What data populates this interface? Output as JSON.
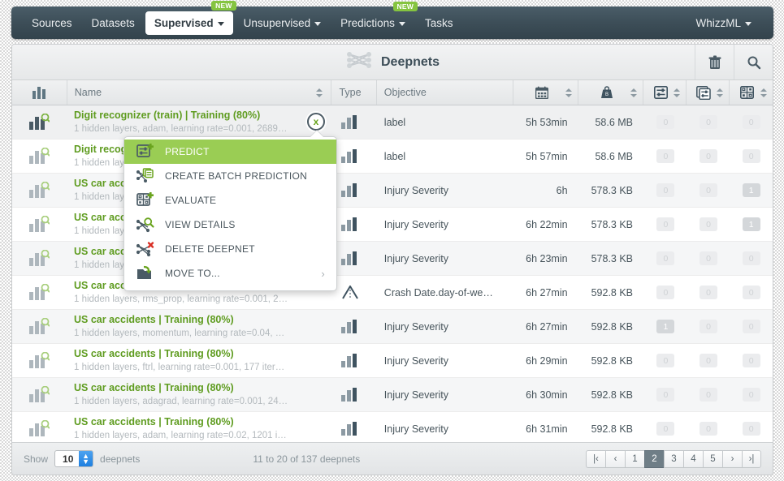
{
  "nav": {
    "items": [
      {
        "label": "Sources",
        "caret": false,
        "active": false,
        "badge": null
      },
      {
        "label": "Datasets",
        "caret": false,
        "active": false,
        "badge": null
      },
      {
        "label": "Supervised",
        "caret": true,
        "active": true,
        "badge": "NEW"
      },
      {
        "label": "Unsupervised",
        "caret": true,
        "active": false,
        "badge": null
      },
      {
        "label": "Predictions",
        "caret": true,
        "active": false,
        "badge": "NEW"
      },
      {
        "label": "Tasks",
        "caret": false,
        "active": false,
        "badge": null
      }
    ],
    "account": {
      "label": "WhizzML",
      "caret": true
    }
  },
  "titlebar": {
    "title": "Deepnets",
    "icon": "deepnet-icon",
    "actions": [
      {
        "name": "trash-icon",
        "title": "Delete"
      },
      {
        "name": "search-icon",
        "title": "Search"
      }
    ]
  },
  "table": {
    "headers": {
      "icon": "",
      "name": "Name",
      "type": "Type",
      "objective": "Objective",
      "date": "calendar-icon",
      "size": "weight-icon",
      "metric1": "prediction-icon",
      "metric2": "batch-prediction-icon",
      "metric3": "evaluation-icon"
    },
    "rows": [
      {
        "name": "Digit recognizer (train) | Training (80%)",
        "desc": "1 hidden layers, adam, learning rate=0.001, 2689…",
        "type": "classification",
        "objective": "label",
        "date": "5h 53min",
        "size": "58.6 MB",
        "m1": "0",
        "m2": "0",
        "m3": "0",
        "m1_filled": false,
        "m2_filled": false,
        "m3_filled": false
      },
      {
        "name": "Digit recognizer (train) | Training (80%)",
        "desc": "1 hidden layers, adam, learning rate=0.001, 26…",
        "type": "classification",
        "objective": "label",
        "date": "5h 57min",
        "size": "58.6 MB",
        "m1": "0",
        "m2": "0",
        "m3": "0",
        "m1_filled": false,
        "m2_filled": false,
        "m3_filled": false
      },
      {
        "name": "US car accidents | Training (80%)",
        "desc": "1 hidden layers, learning rate=0.001, 2…",
        "type": "classification",
        "objective": "Injury Severity",
        "date": "6h",
        "size": "578.3 KB",
        "m1": "0",
        "m2": "0",
        "m3": "1",
        "m1_filled": false,
        "m2_filled": false,
        "m3_filled": true
      },
      {
        "name": "US car accidents | Training (80%)",
        "desc": "1 hidden layers, learning rate=0.001, 2…",
        "type": "classification",
        "objective": "Injury Severity",
        "date": "6h 22min",
        "size": "578.3 KB",
        "m1": "0",
        "m2": "0",
        "m3": "1",
        "m1_filled": false,
        "m2_filled": false,
        "m3_filled": true
      },
      {
        "name": "US car accidents | Training (80%)",
        "desc": "1 hidden layers, learning rate=0.001, 2…",
        "type": "classification",
        "objective": "Injury Severity",
        "date": "6h 23min",
        "size": "578.3 KB",
        "m1": "0",
        "m2": "0",
        "m3": "0",
        "m1_filled": false,
        "m2_filled": false,
        "m3_filled": false
      },
      {
        "name": "US car accidents | Training (80%)",
        "desc": "1 hidden layers, rms_prop, learning rate=0.001, 2…",
        "type": "regression",
        "objective": "Crash Date.day-of-we…",
        "date": "6h 27min",
        "size": "592.8 KB",
        "m1": "0",
        "m2": "0",
        "m3": "0",
        "m1_filled": false,
        "m2_filled": false,
        "m3_filled": false
      },
      {
        "name": "US car accidents | Training (80%)",
        "desc": "1 hidden layers, momentum, learning rate=0.04, …",
        "type": "classification",
        "objective": "Injury Severity",
        "date": "6h 27min",
        "size": "592.8 KB",
        "m1": "1",
        "m2": "0",
        "m3": "0",
        "m1_filled": true,
        "m2_filled": false,
        "m3_filled": false
      },
      {
        "name": "US car accidents | Training (80%)",
        "desc": "1 hidden layers, ftrl, learning rate=0.001, 177 iter…",
        "type": "classification",
        "objective": "Injury Severity",
        "date": "6h 29min",
        "size": "592.8 KB",
        "m1": "0",
        "m2": "0",
        "m3": "0",
        "m1_filled": false,
        "m2_filled": false,
        "m3_filled": false
      },
      {
        "name": "US car accidents | Training (80%)",
        "desc": "1 hidden layers, adagrad, learning rate=0.001, 24…",
        "type": "classification",
        "objective": "Injury Severity",
        "date": "6h 30min",
        "size": "592.8 KB",
        "m1": "0",
        "m2": "0",
        "m3": "0",
        "m1_filled": false,
        "m2_filled": false,
        "m3_filled": false
      },
      {
        "name": "US car accidents | Training (80%)",
        "desc": "1 hidden layers, adam, learning rate=0.02, 1201 i…",
        "type": "classification",
        "objective": "Injury Severity",
        "date": "6h 31min",
        "size": "592.8 KB",
        "m1": "0",
        "m2": "0",
        "m3": "0",
        "m1_filled": false,
        "m2_filled": false,
        "m3_filled": false
      }
    ]
  },
  "context_menu": {
    "items": [
      {
        "label": "PREDICT",
        "icon": "predict-icon",
        "selected": true,
        "submenu": false
      },
      {
        "label": "CREATE BATCH PREDICTION",
        "icon": "batch-prediction-icon",
        "selected": false,
        "submenu": false
      },
      {
        "label": "EVALUATE",
        "icon": "evaluate-icon",
        "selected": false,
        "submenu": false
      },
      {
        "label": "VIEW DETAILS",
        "icon": "view-details-icon",
        "selected": false,
        "submenu": false
      },
      {
        "label": "DELETE DEEPNET",
        "icon": "delete-deepnet-icon",
        "selected": false,
        "submenu": false
      },
      {
        "label": "MOVE TO...",
        "icon": "move-to-icon",
        "selected": false,
        "submenu": true
      }
    ],
    "submenu_arrow": "›"
  },
  "footer": {
    "show_label": "Show",
    "page_size": "10",
    "entity_label": "deepnets",
    "counts": "11 to 20 of 137 deepnets",
    "pagination": [
      {
        "label": "|‹",
        "name": "first-page",
        "active": false
      },
      {
        "label": "‹",
        "name": "prev-page",
        "active": false
      },
      {
        "label": "1",
        "name": "page-1",
        "active": false
      },
      {
        "label": "2",
        "name": "page-2",
        "active": true
      },
      {
        "label": "3",
        "name": "page-3",
        "active": false
      },
      {
        "label": "4",
        "name": "page-4",
        "active": false
      },
      {
        "label": "5",
        "name": "page-5",
        "active": false
      },
      {
        "label": "›",
        "name": "next-page",
        "active": false
      },
      {
        "label": "›|",
        "name": "last-page",
        "active": false
      }
    ]
  },
  "colors": {
    "nav_bg": "#3d4e58",
    "accent_green": "#85c440",
    "name_green": "#5f9c20",
    "menu_selected": "#9acd54"
  }
}
